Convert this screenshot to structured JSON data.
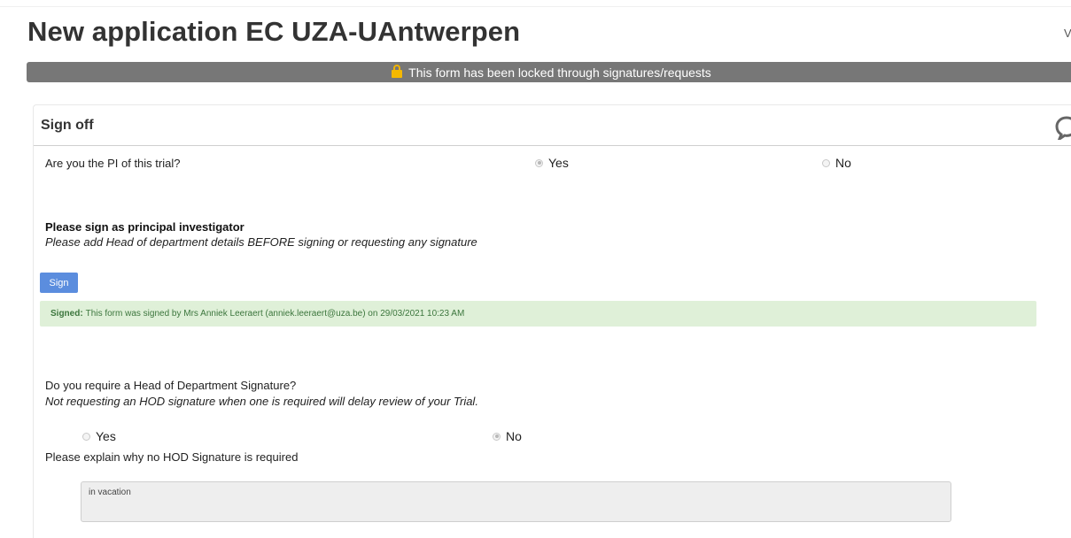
{
  "page": {
    "title": "New application EC UZA-UAntwerpen",
    "top_right_text": "V"
  },
  "lock_banner": {
    "text": "This form has been locked through signatures/requests",
    "icon": "lock-icon"
  },
  "section": {
    "title": "Sign off",
    "comment_icon": "comment-icon"
  },
  "pi_question": {
    "label": "Are you the PI of this trial?",
    "options": [
      {
        "label": "Yes",
        "selected": true
      },
      {
        "label": "No",
        "selected": false
      }
    ]
  },
  "pi_sign": {
    "heading": "Please sign as principal investigator",
    "subtext": "Please add Head of department details BEFORE signing or requesting any signature",
    "button_label": "Sign"
  },
  "signed_alert": {
    "strong": "Signed:",
    "text": "This form was signed by Mrs Anniek Leeraert (anniek.leeraert@uza.be) on 29/03/2021 10:23 AM"
  },
  "hod_question": {
    "label": "Do you require a Head of Department Signature?",
    "subtext": "Not requesting an HOD signature when one is required will delay review of your Trial.",
    "options": [
      {
        "label": "Yes",
        "selected": false
      },
      {
        "label": "No",
        "selected": true
      }
    ]
  },
  "hod_explain": {
    "label": "Please explain why no HOD Signature is required",
    "value": "in vacation"
  },
  "colors": {
    "banner_bg": "#777777",
    "lock_icon": "#f5b800",
    "sign_button": "#5b8dde",
    "signed_bg": "#dff0d8",
    "signed_text": "#3c763d"
  }
}
